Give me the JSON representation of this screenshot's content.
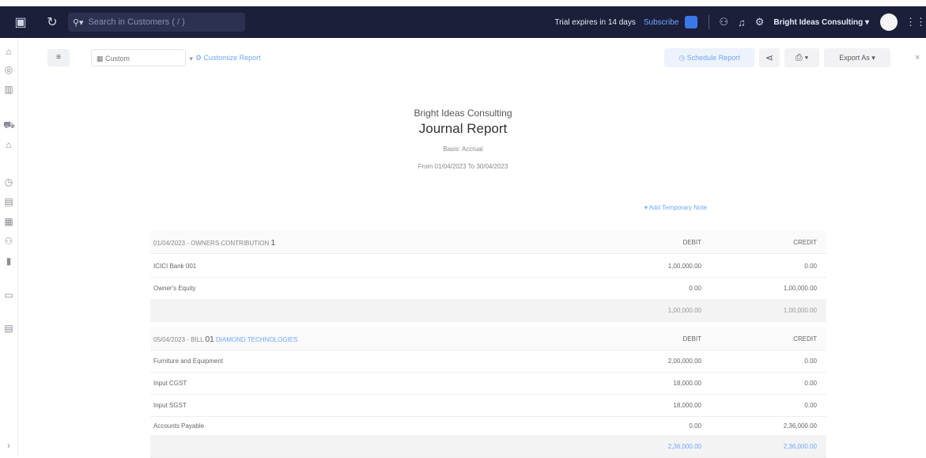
{
  "topbar": {
    "search_placeholder": "Search in Customers ( / )",
    "trial_text": "Trial expires in 14 days",
    "subscribe_label": "Subscribe",
    "org_name": "Bright Ideas Consulting"
  },
  "toolbar": {
    "period_label": "Custom",
    "customize_label": "Customize Report",
    "schedule_label": "Schedule Report",
    "export_label": "Export As"
  },
  "report": {
    "company": "Bright Ideas Consulting",
    "title": "Journal Report",
    "basis": "Basis: Accrual",
    "date_range": "From 01/04/2023 To 30/04/2023",
    "add_note": "Add Temporary Note"
  },
  "journals": [
    {
      "header": "01/04/2023 - OWNERS CONTRIBUTION",
      "header_extra": "1",
      "party": "",
      "debit_label": "DEBIT",
      "credit_label": "CREDIT",
      "lines": [
        {
          "account": "ICICI Bank 001",
          "debit": "1,00,000.00",
          "credit": "0.00"
        },
        {
          "account": "Owner's Equity",
          "debit": "0.00",
          "credit": "1,00,000.00"
        }
      ],
      "total_debit": "1,00,000.00",
      "total_credit": "1,00,000.00"
    },
    {
      "header": "05/04/2023 - BILL",
      "header_extra": "01",
      "party": "DIAMOND TECHNOLOGIES",
      "debit_label": "DEBIT",
      "credit_label": "CREDIT",
      "lines": [
        {
          "account": "Furniture and Equipment",
          "debit": "2,00,000.00",
          "credit": "0.00"
        },
        {
          "account": "Input CGST",
          "debit": "18,000.00",
          "credit": "0.00"
        },
        {
          "account": "Input SGST",
          "debit": "18,000.00",
          "credit": "0.00"
        },
        {
          "account": "Accounts Payable",
          "debit": "0.00",
          "credit": "2,36,000.00"
        }
      ],
      "total_debit": "2,36,000.00",
      "total_credit": "2,36,000.00"
    }
  ]
}
